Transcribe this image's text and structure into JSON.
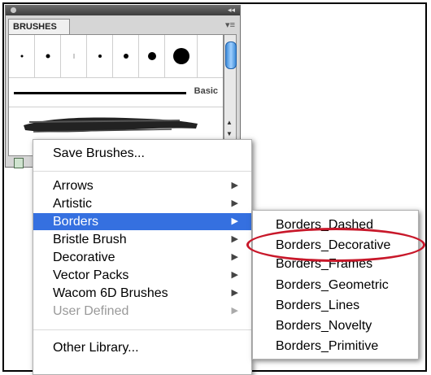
{
  "panel": {
    "tab_label": "BRUSHES",
    "basic_label": "Basic"
  },
  "menu": {
    "save_label": "Save Brushes...",
    "items": [
      {
        "label": "Arrows"
      },
      {
        "label": "Artistic"
      },
      {
        "label": "Borders"
      },
      {
        "label": "Bristle Brush"
      },
      {
        "label": "Decorative"
      },
      {
        "label": "Vector Packs"
      },
      {
        "label": "Wacom 6D Brushes"
      },
      {
        "label": "User Defined"
      }
    ],
    "selected_item": "Borders",
    "disabled_item": "User Defined",
    "other_label": "Other Library..."
  },
  "submenu": {
    "items": [
      {
        "label": "Borders_Dashed"
      },
      {
        "label": "Borders_Decorative"
      },
      {
        "label": "Borders_Frames"
      },
      {
        "label": "Borders_Geometric"
      },
      {
        "label": "Borders_Lines"
      },
      {
        "label": "Borders_Novelty"
      },
      {
        "label": "Borders_Primitive"
      }
    ],
    "circled_item": "Borders_Decorative"
  },
  "colors": {
    "selection": "#3570e0",
    "highlight_circle": "#c8182a"
  }
}
